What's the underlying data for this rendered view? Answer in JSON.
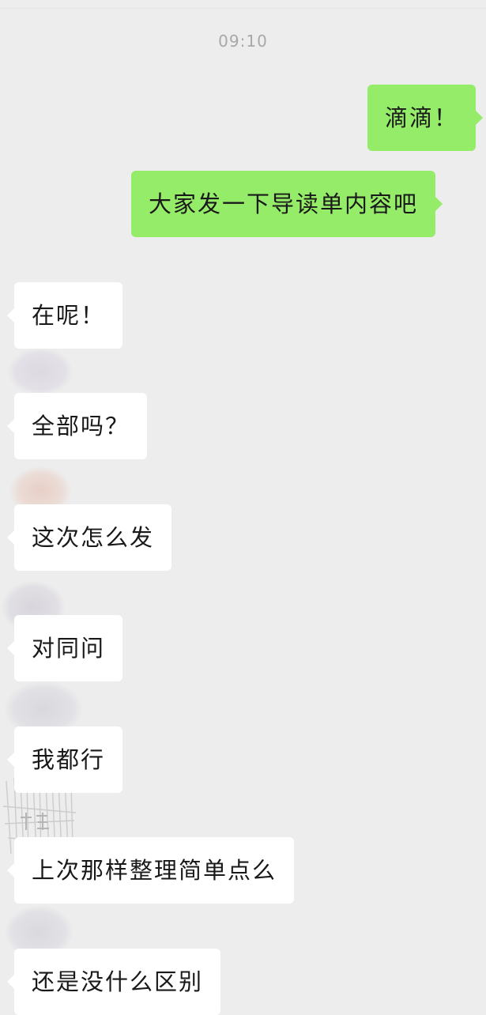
{
  "chat": {
    "timestamp": "09:10",
    "messages": [
      {
        "direction": "out",
        "text": "滴滴！"
      },
      {
        "direction": "out",
        "text": "大家发一下导读单内容吧"
      },
      {
        "direction": "in",
        "text": "在呢！"
      },
      {
        "direction": "in",
        "text": "全部吗？"
      },
      {
        "direction": "in",
        "text": "这次怎么发"
      },
      {
        "direction": "in",
        "text": "对同问"
      },
      {
        "direction": "in",
        "text": "我都行"
      },
      {
        "direction": "in",
        "text": "上次那样整理简单点么"
      },
      {
        "direction": "in",
        "text": "还是没什么区别"
      }
    ]
  },
  "colors": {
    "background": "#ededed",
    "outgoing_bubble": "#95ec69",
    "incoming_bubble": "#ffffff",
    "timestamp": "#a8a8a8"
  }
}
